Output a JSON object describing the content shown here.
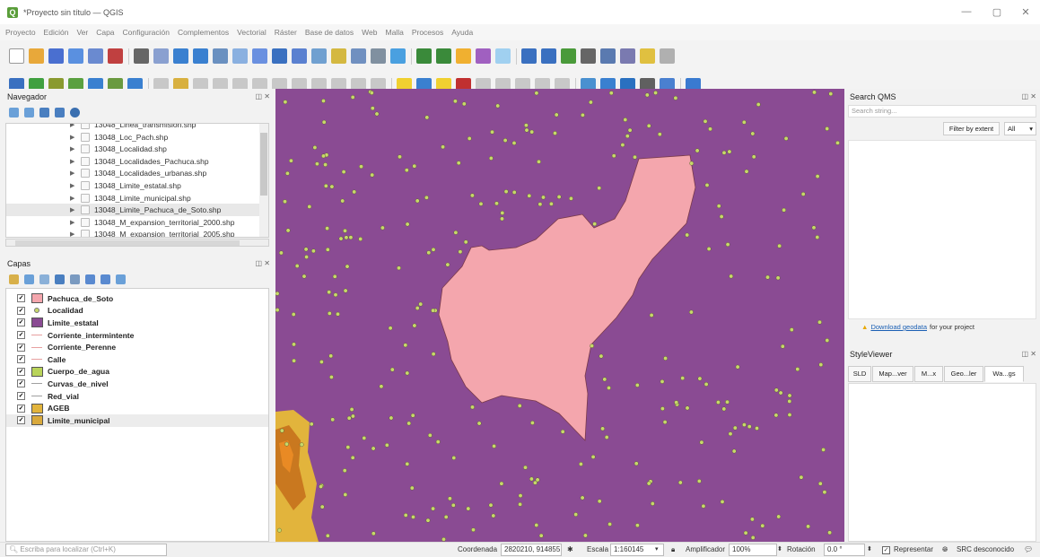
{
  "window": {
    "title": "*Proyecto sin título — QGIS",
    "minimize": "—",
    "maximize": "▢",
    "close": "✕"
  },
  "menu": [
    "Proyecto",
    "Edición",
    "Ver",
    "Capa",
    "Configuración",
    "Complementos",
    "Vectorial",
    "Ráster",
    "Base de datos",
    "Web",
    "Malla",
    "Procesos",
    "Ayuda"
  ],
  "browser_panel": {
    "title": "Navegador",
    "items": [
      "13048_Linea_transmision.shp",
      "13048_Loc_Pach.shp",
      "13048_Localidad.shp",
      "13048_Localidades_Pachuca.shp",
      "13048_Localidades_urbanas.shp",
      "13048_Limite_estatal.shp",
      "13048_Limite_municipal.shp",
      "13048_Limite_Pachuca_de_Soto.shp",
      "13048_M_expansion_territorial_2000.shp",
      "13048_M_expansion_territorial_2005.shp"
    ],
    "selected_index": 7
  },
  "layers_panel": {
    "title": "Capas",
    "layers": [
      {
        "name": "Pachuca_de_Soto",
        "symbol": "box",
        "color": "#f4a6ad"
      },
      {
        "name": "Localidad",
        "symbol": "dot",
        "color": "#c7d86a"
      },
      {
        "name": "Limite_estatal",
        "symbol": "box",
        "color": "#8a4b93"
      },
      {
        "name": "Corriente_intermintente",
        "symbol": "line",
        "color": "#e7a0a0"
      },
      {
        "name": "Corriente_Perenne",
        "symbol": "line",
        "color": "#e7a0a0"
      },
      {
        "name": "Calle",
        "symbol": "line",
        "color": "#e7a0a0"
      },
      {
        "name": "Cuerpo_de_agua",
        "symbol": "box",
        "color": "#b9d45a"
      },
      {
        "name": "Curvas_de_nivel",
        "symbol": "line",
        "color": "#a0a0a0"
      },
      {
        "name": "Red_vial",
        "symbol": "line",
        "color": "#a0a0a0"
      },
      {
        "name": "AGEB",
        "symbol": "box",
        "color": "#e2b43c"
      },
      {
        "name": "Limite_municipal",
        "symbol": "box",
        "color": "#d9a93c"
      }
    ],
    "selected_index": 10
  },
  "right_panel": {
    "qms_title": "Search QMS",
    "search_placeholder": "Search string...",
    "filter_button": "Filter by extent",
    "filter_option": "All",
    "download_link": "Download geodata",
    "download_suffix": "for your project",
    "styleviewer_title": "StyleViewer",
    "tabs": [
      "SLD",
      "Map...ver",
      "M...x",
      "Geo...ler",
      "Wa...gs"
    ],
    "active_tab": 4
  },
  "status": {
    "search_placeholder": "Escriba para localizar (Ctrl+K)",
    "coord_label": "Coordenada",
    "coord_value": "2820210, 914855",
    "scale_label": "Escala",
    "scale_value": "1:160145",
    "magnifier_label": "Amplificador",
    "magnifier_value": "100%",
    "rotation_label": "Rotación",
    "rotation_value": "0.0 °",
    "render_label": "Representar",
    "crs_label": "SRC desconocido"
  },
  "map": {
    "background_color": "#8a4b93",
    "polygon_color": "#f4a6ad",
    "point_color": "#c7d86a"
  }
}
